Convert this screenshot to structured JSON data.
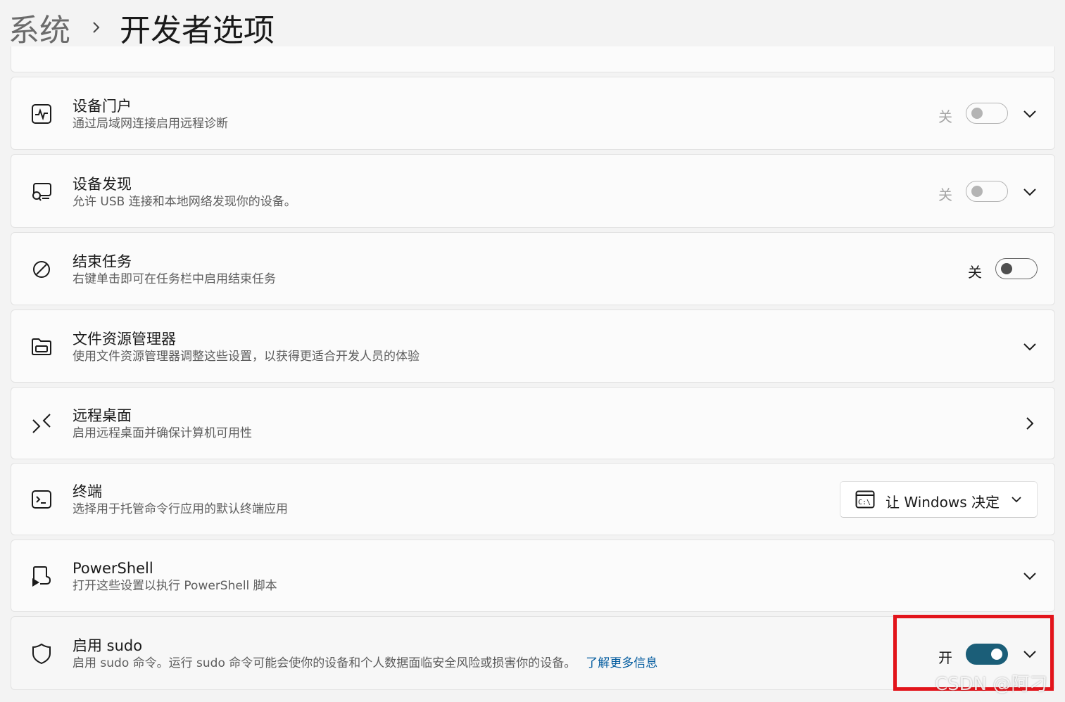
{
  "breadcrumb": {
    "parent": "系统",
    "current": "开发者选项"
  },
  "colors": {
    "accent_toggle_on": "#1b5e78",
    "link": "#005a9e",
    "highlight": "#e2141b"
  },
  "settings": [
    {
      "icon": "pulse-icon",
      "title": "设备门户",
      "subtitle": "通过局域网连接启用远程诊断",
      "toggle_state": "关",
      "toggle_on": false,
      "toggle_disabled": true,
      "expandable": true
    },
    {
      "icon": "device-discovery-icon",
      "title": "设备发现",
      "subtitle": "允许 USB 连接和本地网络发现你的设备。",
      "toggle_state": "关",
      "toggle_on": false,
      "toggle_disabled": true,
      "expandable": true
    },
    {
      "icon": "block-icon",
      "title": "结束任务",
      "subtitle": "右键单击即可在任务栏中启用结束任务",
      "toggle_state": "关",
      "toggle_on": false,
      "toggle_disabled": false
    },
    {
      "icon": "folder-icon",
      "title": "文件资源管理器",
      "subtitle": "使用文件资源管理器调整这些设置，以获得更适合开发人员的体验",
      "expandable": true
    },
    {
      "icon": "remote-desktop-icon",
      "title": "远程桌面",
      "subtitle": "启用远程桌面并确保计算机可用性",
      "navigates": true
    },
    {
      "icon": "terminal-icon",
      "title": "终端",
      "subtitle": "选择用于托管命令行应用的默认终端应用",
      "dropdown_value": "让 Windows 决定",
      "dropdown_icon": "cmd-icon"
    },
    {
      "icon": "powershell-icon",
      "title": "PowerShell",
      "subtitle": "打开这些设置以执行 PowerShell 脚本",
      "expandable": true
    },
    {
      "icon": "shield-icon",
      "title": "启用 sudo",
      "subtitle": "启用 sudo 命令。运行 sudo 命令可能会使你的设备和个人数据面临安全风险或损害你的设备。",
      "link": "了解更多信息",
      "toggle_state": "开",
      "toggle_on": true,
      "toggle_disabled": false,
      "expandable": true
    }
  ],
  "watermark": "CSDN @阿刁"
}
